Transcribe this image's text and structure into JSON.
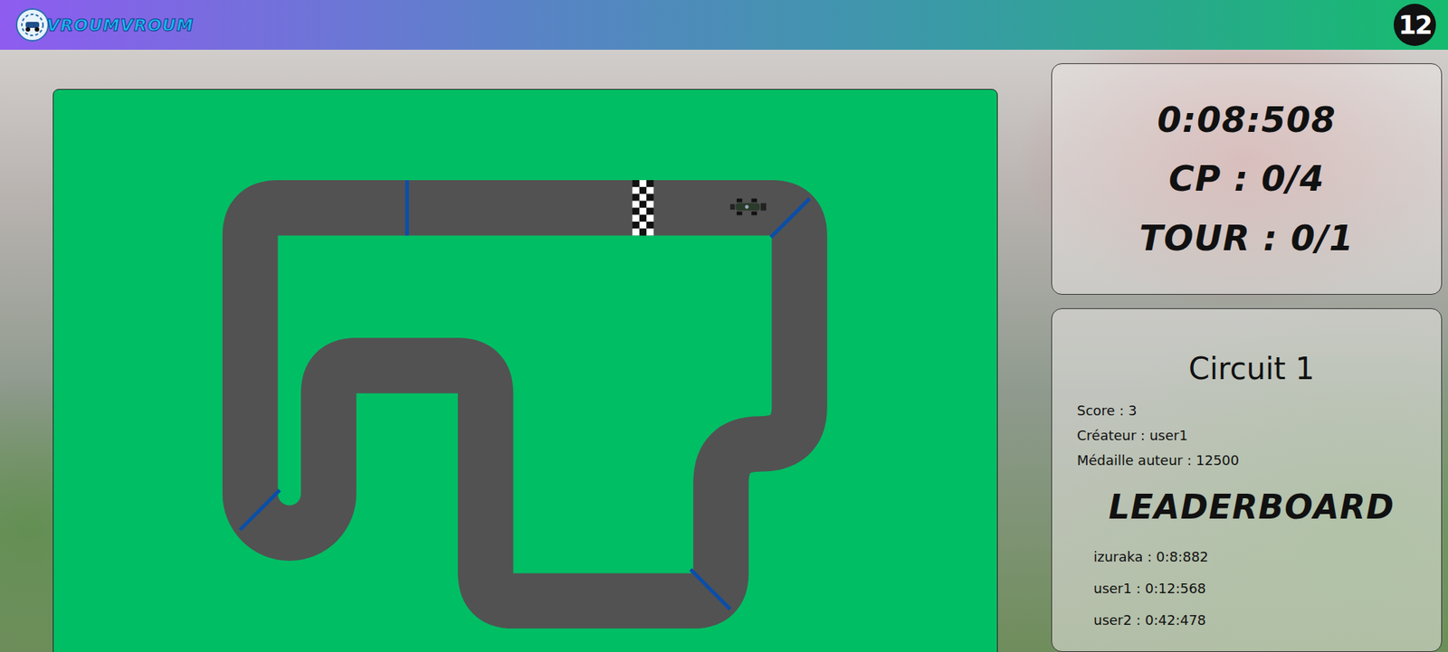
{
  "header": {
    "logo_text": "VROUMVROUM",
    "badge": "12"
  },
  "hud": {
    "time": "0:08:508",
    "checkpoints": "CP : 0/4",
    "lap": "TOUR : 0/1"
  },
  "circuit": {
    "name": "Circuit 1",
    "info": [
      "Score : 3",
      "Créateur : user1",
      "Médaille auteur : 12500"
    ]
  },
  "leaderboard": {
    "title": "LEADERBOARD",
    "entries": [
      "izuraka : 0:8:882",
      "user1 : 0:12:568",
      "user2 : 0:42:478"
    ]
  }
}
